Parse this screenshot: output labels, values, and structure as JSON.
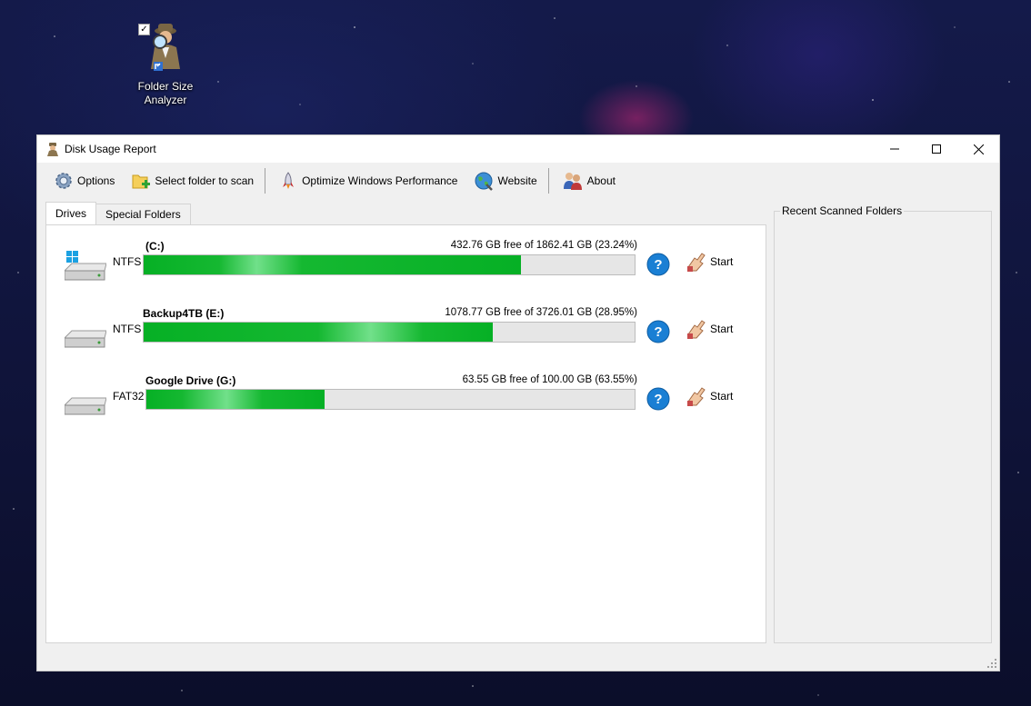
{
  "desktop": {
    "icon_label_line1": "Folder Size",
    "icon_label_line2": "Analyzer",
    "checkbox_mark": "✓"
  },
  "window": {
    "title": "Disk Usage Report",
    "controls": {
      "minimize": "—",
      "maximize": "☐",
      "close": "✕"
    }
  },
  "toolbar": {
    "options": "Options",
    "select_folder": "Select folder to scan",
    "optimize": "Optimize Windows Performance",
    "website": "Website",
    "about": "About"
  },
  "tabs": [
    {
      "label": "Drives",
      "active": true
    },
    {
      "label": "Special Folders",
      "active": false
    }
  ],
  "drives": [
    {
      "fs": "NTFS",
      "name": "(C:)",
      "free_text": "432.76 GB free of 1862.41 GB (23.24%)",
      "used_fraction": 0.7676,
      "start": "Start",
      "help": "?"
    },
    {
      "fs": "NTFS",
      "name": "Backup4TB (E:)",
      "free_text": "1078.77 GB free of 3726.01 GB (28.95%)",
      "used_fraction": 0.7105,
      "start": "Start",
      "help": "?"
    },
    {
      "fs": "FAT32",
      "name": "Google Drive (G:)",
      "free_text": "63.55 GB free of 100.00 GB (63.55%)",
      "used_fraction": 0.3645,
      "start": "Start",
      "help": "?"
    }
  ],
  "recent": {
    "title": "Recent Scanned Folders"
  },
  "colors": {
    "bar_fill": "#06b025",
    "help_blue": "#1a7fd4"
  }
}
